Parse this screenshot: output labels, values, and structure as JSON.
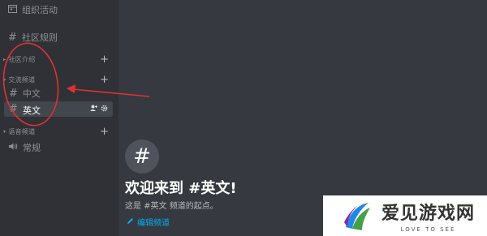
{
  "sidebar": {
    "items": [
      {
        "label": "组织活动",
        "icon": "calendar-icon"
      },
      {
        "label": "社区规则",
        "icon": "hash-icon"
      }
    ],
    "categories": [
      {
        "label": "社区介绍"
      },
      {
        "label": "交流频道",
        "channels": [
          {
            "label": "中文",
            "icon": "hash-icon"
          },
          {
            "label": "英文",
            "icon": "hash-icon",
            "selected": true
          }
        ]
      },
      {
        "label": "语音频道",
        "channels": [
          {
            "label": "常规",
            "icon": "speaker-icon"
          }
        ]
      }
    ]
  },
  "main": {
    "welcome_title": "欢迎来到 #英文!",
    "welcome_subtitle": "这是 #英文 频道的起点。",
    "edit_link": "编辑频道"
  },
  "watermark": {
    "cn": "爱见游戏网",
    "en": "LOVE TO SEE"
  },
  "colors": {
    "sidebar_bg": "#2f3136",
    "main_bg": "#36393f",
    "selected_bg": "#42464d",
    "link": "#00aff4",
    "annotation": "#e03131"
  }
}
